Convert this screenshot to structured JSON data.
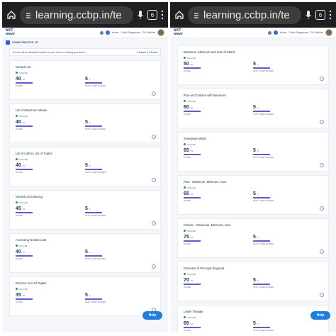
{
  "browser": {
    "url": "learning.ccbp.in/te",
    "tab_count": "6"
  },
  "header": {
    "logo_line1": "NXT",
    "logo_line2": "wave",
    "nav_home": "Home",
    "nav_playground": "Code Playground",
    "user": "Sri Likhitha"
  },
  "left": {
    "breadcrumb": "CODING PRACTICE - 28",
    "info_text": "Points will be allocated based on your score in coding questions",
    "info_score": "1 Score = 1 Point",
    "cards": [
      {
        "title": "Nested List",
        "status": "SOLVED",
        "score": "40",
        "score_max": "40",
        "score_label": "SCORE",
        "tests": "5",
        "tests_max": "5",
        "tests_label": "TEST CASES PASSED"
      },
      {
        "title": "List of Maximum Values",
        "status": "SOLVED",
        "score": "40",
        "score_max": "40",
        "score_label": "SCORE",
        "tests": "5",
        "tests_max": "5",
        "tests_label": "TEST CASES PASSED"
      },
      {
        "title": "List of Lists to List of Tuples",
        "status": "SOLVED",
        "score": "40",
        "score_max": "40",
        "score_label": "SCORE",
        "tests": "5",
        "tests_max": "5",
        "tests_label": "TEST CASES PASSED"
      },
      {
        "title": "Nested List Indexing",
        "status": "SOLVED",
        "score": "45",
        "score_max": "45",
        "score_label": "SCORE",
        "tests": "5",
        "tests_max": "5",
        "tests_label": "TEST CASES PASSED"
      },
      {
        "title": "Accessing Nested Lists",
        "status": "SOLVED",
        "score": "40",
        "score_max": "40",
        "score_label": "SCORE",
        "tests": "5",
        "tests_max": "5",
        "tests_label": "TEST CASES PASSED"
      },
      {
        "title": "Remove N in All Tuples",
        "status": "SOLVED",
        "score": "35",
        "score_max": "35",
        "score_label": "SCORE",
        "tests": "5",
        "tests_max": "5",
        "tests_label": "TEST CASES PASSED"
      }
    ]
  },
  "right": {
    "cards": [
      {
        "title": "Maximum, Minimum and Sum of Matrix",
        "status": "SOLVED",
        "score": "50",
        "score_max": "50",
        "score_label": "SCORE",
        "tests": "5",
        "tests_max": "5",
        "tests_label": "TEST CASES PASSED"
      },
      {
        "title": "Row and Column with Maximum",
        "status": "SOLVED",
        "score": "60",
        "score_max": "60",
        "score_label": "SCORE",
        "tests": "5",
        "tests_max": "5",
        "tests_label": "TEST CASES PASSED"
      },
      {
        "title": "Transpose Matrix",
        "status": "SOLVED",
        "score": "65",
        "score_max": "65",
        "score_label": "SCORE",
        "tests": "5",
        "tests_max": "5",
        "tests_label": "TEST CASES PASSED"
      },
      {
        "title": "Row - Maximum, Minimum, Sum",
        "status": "SOLVED",
        "score": "65",
        "score_max": "65",
        "score_label": "SCORE",
        "tests": "5",
        "tests_max": "5",
        "tests_label": "TEST CASES PASSED"
      },
      {
        "title": "Column - Maximum, Minimum, Sum",
        "status": "SOLVED",
        "score": "75",
        "score_max": "75",
        "score_label": "SCORE",
        "tests": "5",
        "tests_max": "5",
        "tests_label": "TEST CASES PASSED"
      },
      {
        "title": "Elements of Principal Diagonal",
        "status": "SOLVED",
        "score": "70",
        "score_max": "70",
        "score_label": "SCORE",
        "tests": "5",
        "tests_max": "5",
        "tests_label": "TEST CASES PASSED"
      },
      {
        "title": "Lower Triangle",
        "status": "SOLVED",
        "score": "65",
        "score_max": "65",
        "score_label": "SCORE",
        "tests": "5",
        "tests_max": "5",
        "tests_label": "TEST CASES PASSED"
      }
    ]
  },
  "help_label": "Help",
  "colors": {
    "accent": "#2b5fd9",
    "solved": "#1a9f60",
    "progress": "#6b57c6",
    "help": "#1f7fe0"
  }
}
